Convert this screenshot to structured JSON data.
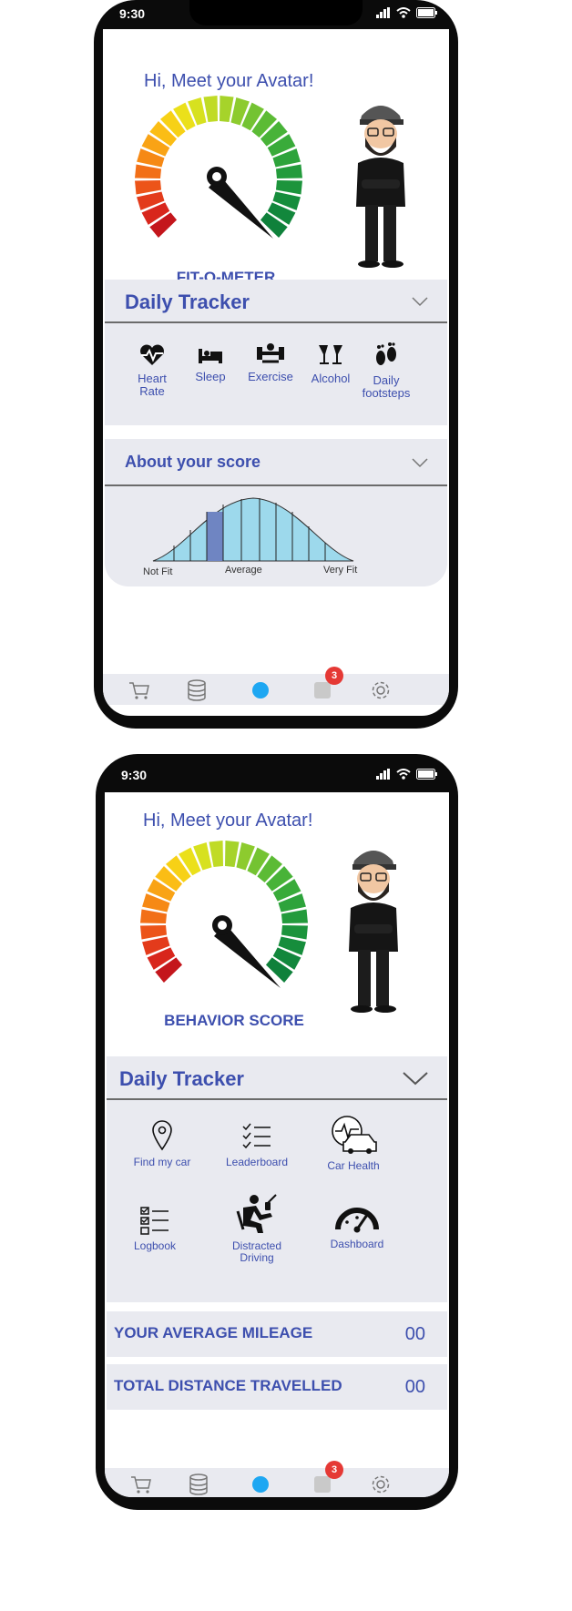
{
  "screen1": {
    "status": {
      "time": "9:30"
    },
    "greeting": "Hi, Meet your Avatar!",
    "gauge_label": "FIT-O-METER",
    "tracker": {
      "title": "Daily Tracker",
      "items": [
        {
          "label": "Heart Rate",
          "icon": "heart-rate-icon"
        },
        {
          "label": "Sleep",
          "icon": "bed-icon"
        },
        {
          "label": "Exercise",
          "icon": "dumbbell-icon"
        },
        {
          "label": "Alcohol",
          "icon": "cheers-icon"
        },
        {
          "label": "Daily footsteps",
          "icon": "footprints-icon"
        }
      ]
    },
    "about": {
      "title": "About your score",
      "labels": {
        "low": "Not Fit",
        "mid": "Average",
        "high": "Very Fit"
      }
    },
    "nav": {
      "badge": "3"
    }
  },
  "screen2": {
    "status": {
      "time": "9:30"
    },
    "greeting": "Hi, Meet your Avatar!",
    "gauge_label": "BEHAVIOR SCORE",
    "tracker": {
      "title": "Daily Tracker",
      "items": [
        {
          "label": "Find my car",
          "icon": "location-pin-icon"
        },
        {
          "label": "Leaderboard",
          "icon": "checklist-icon"
        },
        {
          "label": "Car Health",
          "icon": "car-health-icon"
        },
        {
          "label": "Logbook",
          "icon": "logbook-icon"
        },
        {
          "label": "Distracted Driving",
          "icon": "distracted-driver-icon"
        },
        {
          "label": "Dashboard",
          "icon": "speedometer-icon"
        }
      ]
    },
    "rows": [
      {
        "label": "YOUR AVERAGE MILEAGE",
        "value": "00"
      },
      {
        "label": "TOTAL DISTANCE TRAVELLED",
        "value": "00"
      }
    ],
    "nav": {
      "badge": "3"
    }
  },
  "colors": {
    "accent": "#3d4fae",
    "panel": "#e9eaf0",
    "badge": "#e53935",
    "nav_active": "#1ea7f2"
  }
}
